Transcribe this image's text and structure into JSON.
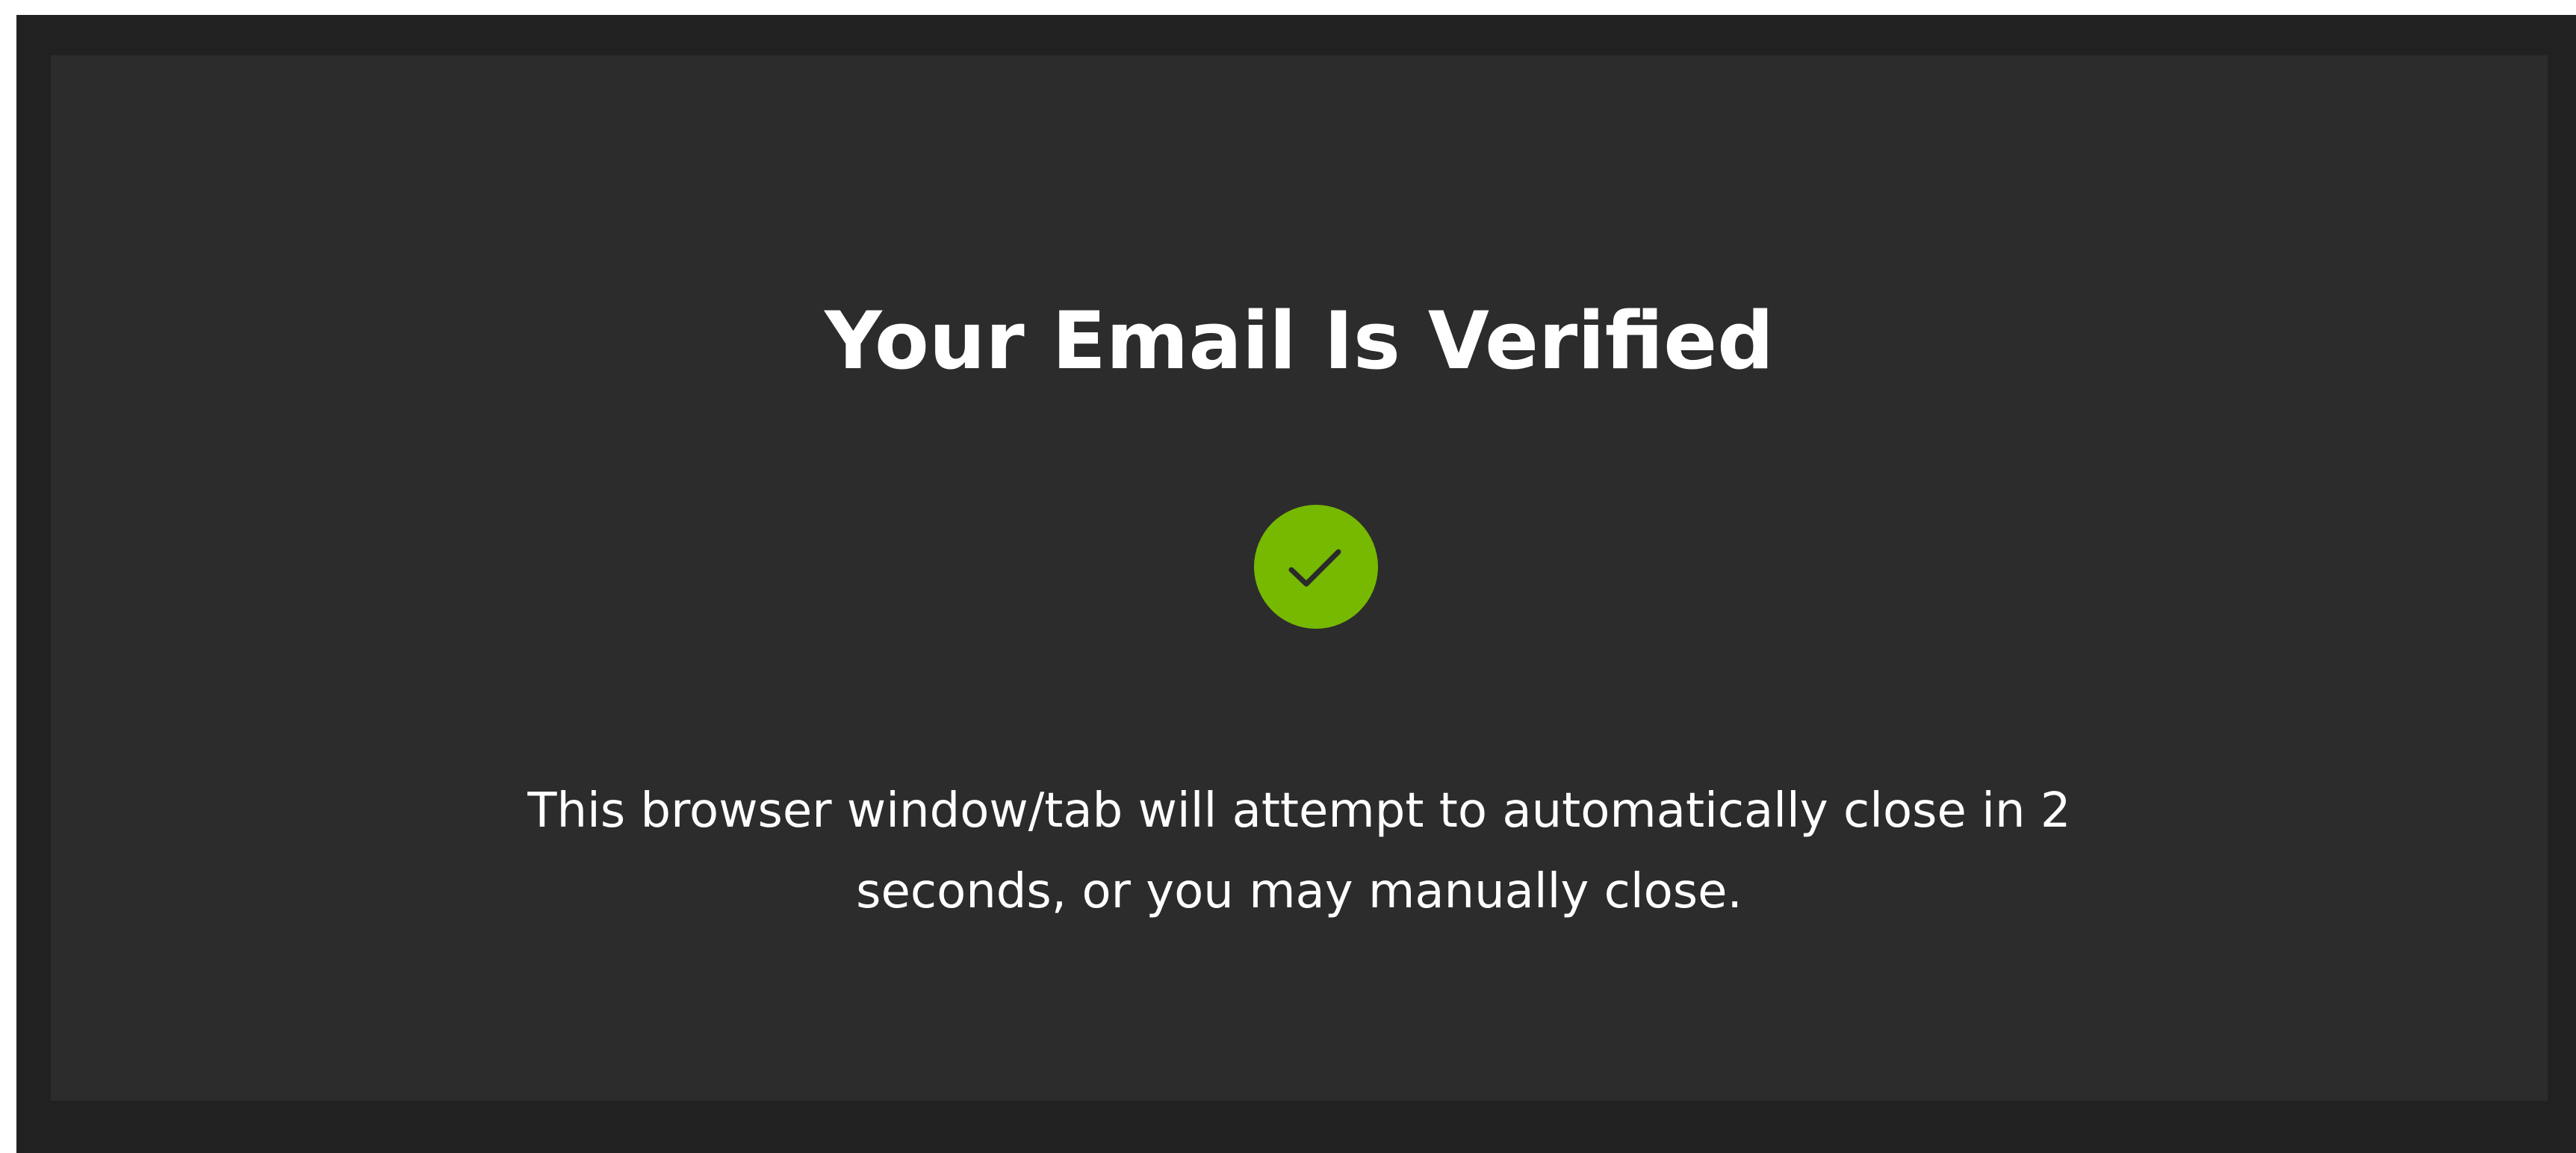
{
  "page": {
    "title": "Your Email Is Verified",
    "message": "This browser window/tab will attempt to automatically close in 2 seconds, or you may manually close.",
    "status_icon": "checkmark-icon"
  },
  "colors": {
    "backdrop": "#212121",
    "card": "#2c2c2c",
    "text": "#ffffff",
    "success": "#76b900",
    "check": "#2a2a2a"
  }
}
